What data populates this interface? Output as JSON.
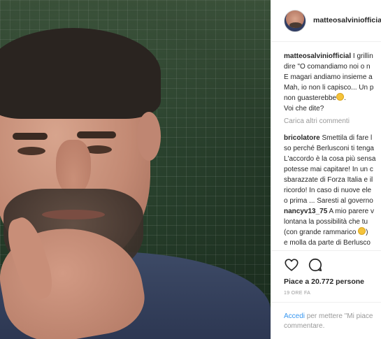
{
  "post": {
    "username": "matteosalviniofficial",
    "caption": {
      "username": "matteosalviniofficial",
      "lines": [
        " I grillin",
        "dire \"O comandiamo noi o n",
        "E magari andiamo insieme a",
        "Mah, io non li capisco... Un p",
        "non guasterebbe",
        "Voi che dite?"
      ]
    },
    "load_more": "Carica altri commenti",
    "comments": [
      {
        "username": "bricolatore",
        "lines": [
          " Smettila di fare l",
          "so perché Berlusconi ti tenga",
          "L'accordo è la cosa più sensa",
          "potesse mai capitare! In un c",
          "sbarazzate di Forza Italia e il",
          "ricordo! In caso di nuove ele",
          "o prima ... Saresti al governo"
        ]
      },
      {
        "username": "nancyv13_75",
        "lines": [
          " A mio parere v",
          "lontana la possibilità che tu",
          "(con grande rammarico ",
          "e molla da parte di Berlusco"
        ]
      }
    ],
    "likes": "Piace a 20.772 persone",
    "timestamp": "19 ORE FA",
    "login_prompt": {
      "link": "Accedi",
      "text_1": " per mettere \"Mi piace",
      "text_2": "commentare."
    },
    "icons": {
      "like": "heart-icon",
      "comment": "comment-icon"
    }
  }
}
